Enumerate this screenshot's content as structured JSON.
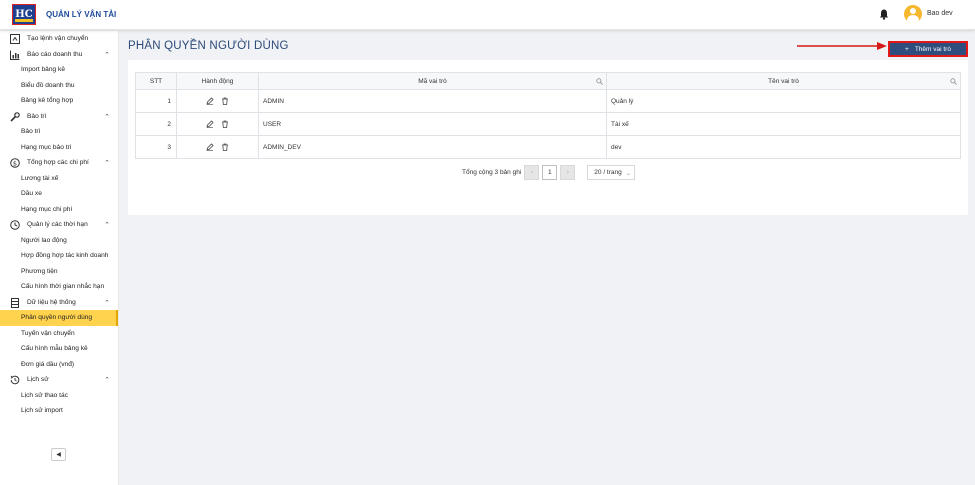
{
  "header": {
    "logo_text": "HC",
    "app_title": "QUẢN LÝ VẬN TẢI",
    "username": "Bao dev"
  },
  "sidebar": {
    "top_item": "Tạo lệnh vận chuyển",
    "groups": [
      {
        "label": "Báo cáo doanh thu",
        "icon": "bar-chart-icon",
        "items": [
          "Import bảng kê",
          "Biểu đồ doanh thu",
          "Bảng kê tổng hợp"
        ]
      },
      {
        "label": "Bảo trì",
        "icon": "wrench-icon",
        "items": [
          "Bảo trì",
          "Hạng mục bảo trì"
        ]
      },
      {
        "label": "Tổng hợp các chi phí",
        "icon": "dollar-icon",
        "items": [
          "Lương tài xế",
          "Dầu xe",
          "Hạng mục chi phí"
        ]
      },
      {
        "label": "Quản lý các thời hạn",
        "icon": "clock-icon",
        "items": [
          "Người lao động",
          "Hợp đồng hợp tác kinh doanh",
          "Phương tiện",
          "Cấu hình thời gian nhắc hạn"
        ]
      },
      {
        "label": "Dữ liệu hệ thống",
        "icon": "database-icon",
        "items": [
          "Phân quyền người dùng",
          "Tuyến vận chuyển",
          "Cấu hình mẫu bảng kê",
          "Đơn giá dầu (vnđ)"
        ]
      },
      {
        "label": "Lịch sử",
        "icon": "history-icon",
        "items": [
          "Lịch sử thao tác",
          "Lịch sử import"
        ]
      }
    ],
    "active_item": "Phân quyền người dùng"
  },
  "main": {
    "page_title": "PHÂN QUYỀN NGƯỜI DÙNG",
    "add_button": "Thêm vai trò",
    "table": {
      "columns": [
        "STT",
        "Hành động",
        "Mã vai trò",
        "Tên vai trò"
      ],
      "rows": [
        {
          "stt": "1",
          "ma": "ADMIN",
          "ten": "Quản lý"
        },
        {
          "stt": "2",
          "ma": "USER",
          "ten": "Tài xế"
        },
        {
          "stt": "3",
          "ma": "ADMIN_DEV",
          "ten": "dev"
        }
      ]
    },
    "pagination": {
      "total_text": "Tổng cộng 3 bản ghi",
      "current_page": "1",
      "page_size": "20 / trang"
    }
  },
  "colors": {
    "accent": "#2f4e7e",
    "active": "#ffd34d",
    "highlight": "#e01818"
  }
}
